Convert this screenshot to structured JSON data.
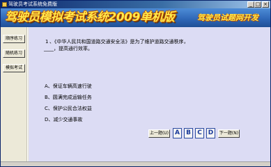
{
  "window": {
    "title": "驾驶员考试系统免费版",
    "minimize": "_",
    "maximize": "□",
    "close": "×"
  },
  "header": {
    "app_name": "驾驶员模拟考试系统2009单机版",
    "slogan": "驾驶员试题网开发"
  },
  "sidebar": {
    "items": [
      {
        "label": "顺序练习"
      },
      {
        "label": "随机练习"
      },
      {
        "label": "模拟考试"
      }
    ]
  },
  "question": {
    "number": "1",
    "text_line1": "、《中华人民共和国道路交通安全法》是为了维护道路交通秩序，",
    "text_line2": "____，提高通行效率。",
    "options": [
      {
        "text": "A、保证车辆高速行驶"
      },
      {
        "text": "B、圆满完成运输任务"
      },
      {
        "text": "C、保护公民合法权益"
      },
      {
        "text": "D、减少交通事故"
      }
    ]
  },
  "nav": {
    "prev_label": "上一题(U)",
    "next_label": "下一题(N)",
    "answers": [
      "A",
      "B",
      "C",
      "D"
    ]
  },
  "colors": {
    "title_bar": "#0a246a",
    "header": "#2f68b8",
    "brand_text": "#ffe94a",
    "content_bg": "#dcdcf4"
  }
}
